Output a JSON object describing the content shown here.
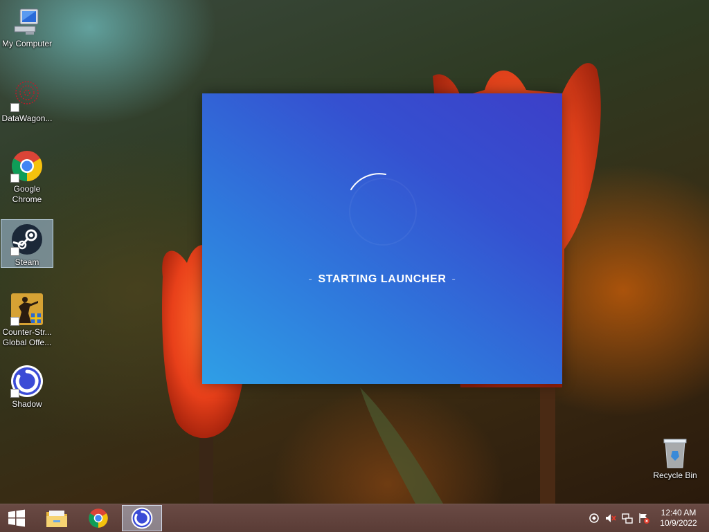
{
  "desktop": {
    "icons": [
      {
        "label": "My Computer",
        "icon": "computer-icon"
      },
      {
        "label": "DataWagon...",
        "icon": "datawagon-icon"
      },
      {
        "label": "Google\nChrome",
        "icon": "chrome-icon"
      },
      {
        "label": "Steam",
        "icon": "steam-icon",
        "selected": true
      },
      {
        "label": "Counter-Str...\nGlobal Offe...",
        "icon": "counter-strike-icon"
      },
      {
        "label": "Shadow",
        "icon": "shadow-icon"
      }
    ],
    "recycle_bin": {
      "label": "Recycle Bin",
      "icon": "recycle-bin-icon"
    }
  },
  "launcher": {
    "status_text": "STARTING LAUNCHER",
    "dash_left": "-",
    "dash_right": "-",
    "colors": {
      "top_right": "#3c3fc8",
      "bottom_left": "#2f9fe6"
    }
  },
  "taskbar": {
    "buttons": [
      {
        "name": "start-button",
        "icon": "windows-icon"
      },
      {
        "name": "file-explorer-button",
        "icon": "folder-icon"
      },
      {
        "name": "chrome-button",
        "icon": "chrome-icon"
      },
      {
        "name": "shadow-button",
        "icon": "shadow-icon",
        "active": true
      }
    ],
    "tray": [
      "sync-icon",
      "speaker-muted-icon",
      "network-icon",
      "action-center-flag-icon"
    ],
    "clock": {
      "time": "12:40 AM",
      "date": "10/9/2022"
    }
  }
}
